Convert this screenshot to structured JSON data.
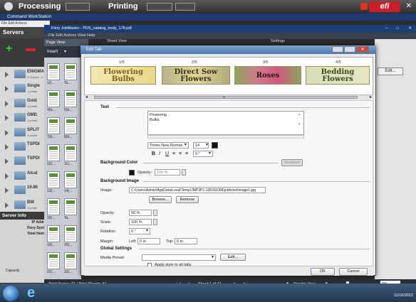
{
  "topbar": {
    "processing": "Processing",
    "printing": "Printing",
    "brand": "efi"
  },
  "cws": {
    "title": "Command WorkStation",
    "menu": "File  Edit  Actions",
    "servers_header": "Servers",
    "servers": [
      {
        "name": "ENIGMA",
        "sub": "5 Groups - 4"
      },
      {
        "name": "Single",
        "sub": "1 printer"
      },
      {
        "name": "Gold",
        "sub": "1 printer"
      },
      {
        "name": "OMD",
        "sub": "1 printer"
      },
      {
        "name": "SPLIT",
        "sub": "4 printer"
      },
      {
        "name": "TSPDI",
        "sub": ""
      },
      {
        "name": "TSPDI",
        "sub": ""
      },
      {
        "name": "Alcat",
        "sub": ""
      },
      {
        "name": "10.86",
        "sub": ""
      },
      {
        "name": "BW",
        "sub": "1 printer"
      }
    ],
    "server_info": {
      "header": "Server Info",
      "rows": [
        "IP Addr",
        "Fiery Syst",
        "Total Hem"
      ],
      "capacity": "Capacity"
    }
  },
  "jobmaster": {
    "title": "Fiery JobMaster - PDS_catalog_body_178.pdf",
    "menu": "File   Edit   Actions   View   Help",
    "page_view": "Page View",
    "sheet_view": "Sheet View",
    "settings": "Settings",
    "insert": "Insert",
    "edit_button": "Edit...",
    "thumb_labels": [
      "1(f...",
      "Ta...",
      "4(b...",
      "5(b...",
      "7(b...",
      "8(b...",
      "10(...",
      "11(...",
      "13(...",
      "14(...",
      "16(...",
      "Ta...",
      "19(...",
      "20(...",
      "22(...",
      "23(..."
    ],
    "status": {
      "total": "Total Pages: 71 | Total Sheets: 41",
      "sheet": "Sheet 1 of 41",
      "reader": "Reader View",
      "zoom": "6%"
    }
  },
  "dialog": {
    "title": "Edit Tab",
    "tab_numbers": [
      "1/5",
      "2/5",
      "3/5",
      "4/5"
    ],
    "tabs": [
      "Flowering\nBulbs",
      "Direct Sow\nFlowers",
      "Roses",
      "Bedding\nFlowers"
    ],
    "scroll_marker": "III",
    "text_section": "Text",
    "text_value": "Flowering\nBulbs",
    "font": "Times New Roman",
    "size": "14",
    "bold": "B",
    "italic": "I",
    "underline": "U",
    "rotation_small": "0 °",
    "bg_color_section": "Background Color",
    "disabled": "Disabled",
    "opacity_label": "Opacity:",
    "opacity_small": "100 %",
    "bg_image_section": "Background Image",
    "image_label": "Image:",
    "image_path": "C:\\Users\\Admin\\AppData\\Local\\Temp\\JMP3P1-135311068\\jobticket\\image1.jpg",
    "browse": "Browse...",
    "remove": "Remove",
    "opacity_value": "50 %",
    "scale_label": "Scale:",
    "scale_value": "100 %",
    "rotation_label": "Rotation:",
    "rotation_value": "0 °",
    "margin_label": "Margin:",
    "left_label": "Left:",
    "left_value": "0 in",
    "top_label": "Top:",
    "top_value": "0 in",
    "global_section": "Global Settings",
    "media_preset_label": "Media Preset:",
    "media_preset_value": "",
    "edit": "Edit...",
    "apply_all": "Apply style to all tabs",
    "ok": "OK",
    "cancel": "Cancel"
  },
  "taskbar": {
    "clock": "11/16/2012"
  }
}
